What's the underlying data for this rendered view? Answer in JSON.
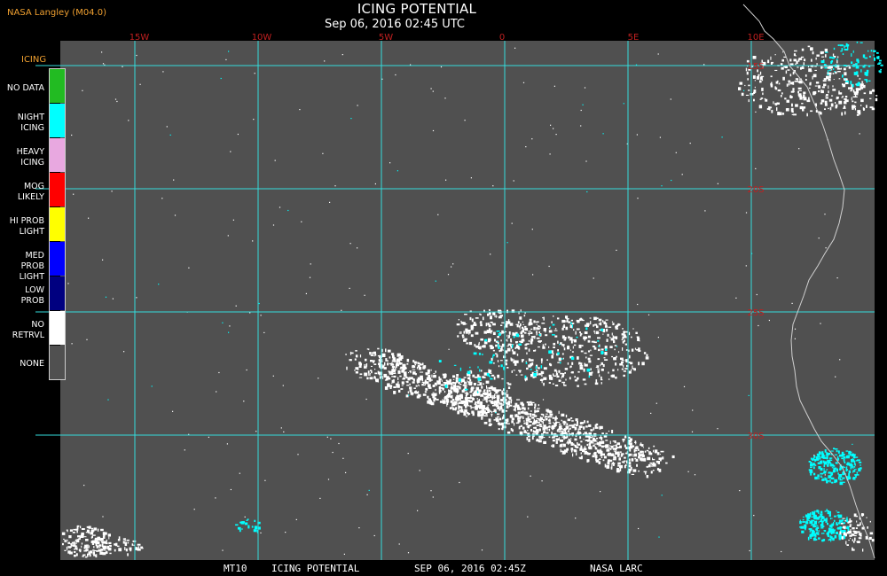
{
  "header": {
    "source": "NASA Langley (M04.0)",
    "title": "ICING POTENTIAL",
    "subtitle": "Sep 06, 2016 02:45 UTC"
  },
  "map": {
    "lon_labels": [
      "15W",
      "10W",
      "5W",
      "0",
      "5E",
      "10E"
    ],
    "lat_labels": [
      "15S",
      "20S",
      "25S",
      "30S"
    ],
    "grid_color": "#33dddd",
    "label_color": "#c02020",
    "background_color": "#505050",
    "coastline_color": "#d0d0d0"
  },
  "legend": {
    "title": "ICING",
    "items": [
      {
        "line1": "NO DATA",
        "line2": "",
        "color": "#22bb22"
      },
      {
        "line1": "NIGHT",
        "line2": "ICING",
        "color": "#00ffff"
      },
      {
        "line1": "HEAVY",
        "line2": "ICING",
        "color": "#e8a8e0"
      },
      {
        "line1": "MOG",
        "line2": "LIKELY",
        "color": "#ff0000"
      },
      {
        "line1": "HI PROB",
        "line2": "LIGHT",
        "color": "#ffff00"
      },
      {
        "line1": "MED PROB",
        "line2": "LIGHT",
        "color": "#0000ff"
      },
      {
        "line1": "LOW",
        "line2": "PROB",
        "color": "#000080"
      },
      {
        "line1": "NO",
        "line2": "RETRVL",
        "color": "#ffffff"
      },
      {
        "line1": "NONE",
        "line2": "",
        "color": "#505050"
      }
    ]
  },
  "footer": {
    "product": "MT10",
    "name": "ICING POTENTIAL",
    "date": "SEP 06, 2016 02:45Z",
    "agency": "NASA LARC"
  }
}
